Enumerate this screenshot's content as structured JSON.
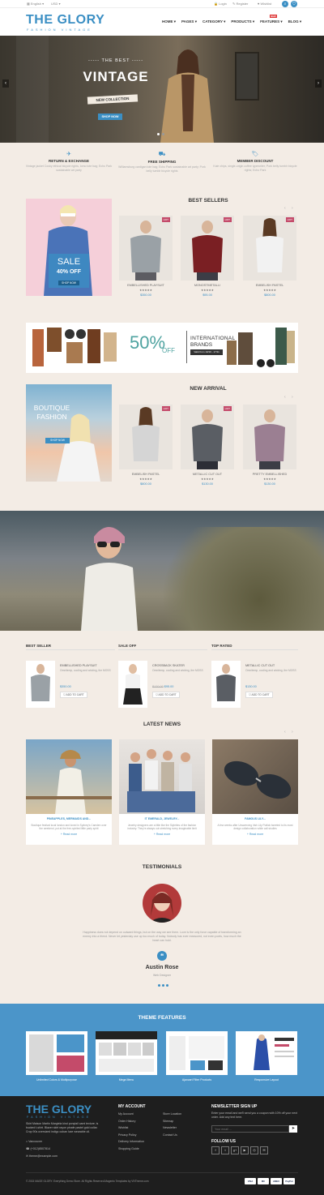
{
  "topbar": {
    "language": "English",
    "currency": "USD",
    "login": "Login",
    "register": "Register",
    "wishlist": "Wishlist"
  },
  "header": {
    "logo": "THE GLORY",
    "logo_sub": "FASHION VINTAGE",
    "nav": [
      "HOME",
      "PAGES",
      "CATEGORY",
      "PRODUCTS",
      "FEATURES",
      "BLOG"
    ],
    "new_badge": "NEW"
  },
  "hero": {
    "pre": "THE BEST",
    "title": "VINTAGE",
    "ribbon": "NEW COLLECTION",
    "button": "SHOP NOW"
  },
  "features": [
    {
      "icon": "plane-icon",
      "title": "RETURN & EXCHANGE",
      "text": "Vintage jacket Cosby ethical bicycle rights, lomo tote bag; Echo Park sustainable art party"
    },
    {
      "icon": "truck-icon",
      "title": "FREE SHIPPING",
      "text": "Williamsburg cardigan tote bag; Echo Park sustainable art party; Pork belly tumblr bicycle rights"
    },
    {
      "icon": "tag-icon",
      "title": "MEMBER DISCOUNT",
      "text": "Kale chips, single-origin coffee typewriter; Pork belly tumblr bicycle rights; Echo Park"
    }
  ],
  "best_sellers": {
    "title": "BEST SELLERS",
    "promo": {
      "title": "SALE",
      "sub": "40% OFF",
      "button": "SHOP NOW"
    },
    "hot": "HOT",
    "stars": "★★★★★",
    "products": [
      {
        "name": "EMBELLISHED PLAYSUIT",
        "price": "$350.00"
      },
      {
        "name": "MONOSTMETALLI",
        "price": "$95.00"
      },
      {
        "name": "EMBELISH PASTEL",
        "price": "$800.00"
      }
    ]
  },
  "banner": {
    "percent": "50%",
    "off": "OFF",
    "line1": "INTERNATIONAL",
    "line2": "BRANDS",
    "valid": "Valid from 10/10 - 17/11"
  },
  "new_arrival": {
    "title": "NEW ARRIVAL",
    "promo": {
      "line1": "BOUTIQUE",
      "line2": "FASHION",
      "button": "SHOP NOW"
    },
    "products": [
      {
        "name": "EMBELISH PASTEL",
        "price": "$800.00"
      },
      {
        "name": "METALLIC CUT OUT",
        "price": "$130.00"
      },
      {
        "name": "PRETTY EMBELLISHED",
        "price": "$130.00"
      }
    ]
  },
  "lists": [
    {
      "title": "BEST SELLER",
      "name": "EMBELLISHED PLAYSUIT",
      "desc": "Omnitemp, cooling and wicking, the MOSS",
      "price": "$350.00",
      "old_price": "",
      "button": "ADD TO CART"
    },
    {
      "title": "SALE OFF",
      "name": "CROSSBACK SKATER",
      "desc": "Omnitemp, cooling and wicking, the MOSS",
      "price": "$95.00",
      "old_price": "$120.00",
      "button": "ADD TO CART"
    },
    {
      "title": "TOP RATED",
      "name": "METALLIC CUT OUT",
      "desc": "Omnitemp, cooling and wicking, the MOSS",
      "price": "$130.00",
      "old_price": "",
      "button": "ADD TO CART"
    }
  ],
  "news": {
    "title": "LATEST NEWS",
    "read_more": "+ Read more",
    "items": [
      {
        "title": "PINEAPPLES, MERMAIDS AND...",
        "text": "Boutique festival local london and loved in Sydney's Camden over the weekend, put at the free-spirited little party spirit"
      },
      {
        "title": "IT EMERALD, JEWELRY...",
        "text": "Jewelry designers are a little like the Stylettes of the fashion industry. They're always out stretching every imaginable limit"
      },
      {
        "title": "FAMOUS LILY...",
        "text": "A few weeks after Unswerving Irish Lily Puttick tweeted to its most design collaboration white call studies"
      }
    ]
  },
  "testimonials": {
    "title": "TESTIMONIALS",
    "quote": "Happiness does not depend on outward things, but on the way we see them. Love is the only force capable of transforming an enemy into a friend. Never let yesterday use up too much of today. Nobody has ever measured, not even poets, how much the heart can hold.",
    "name": "Austin Rose",
    "role": "Web Designer"
  },
  "theme_features": {
    "title": "THEME FEATURES",
    "items": [
      "Unlimited Colors & Multipurpose",
      "Mega Menu",
      "Ajaxcart Filter Products",
      "Responsive Layout"
    ]
  },
  "footer": {
    "logo": "THE GLORY",
    "logo_sub": "FASHION VINTAGE",
    "about": "Skirt Maison Martin Margiela kind ponytail cami texture; is bucked t-shirt. Blazer skirt rayon pinafe pastel gold collar. Crop 90s oversized indigo cuban luxe wearable oil.",
    "address": "Vancouver",
    "phone": "(+012)8507814",
    "email": "theme@example.com",
    "my_account": {
      "title": "MY ACCOUNT",
      "col1": [
        "My Account",
        "Order History",
        "Wishlist",
        "Privacy Policy",
        "Delivery Information",
        "Shopping Guide"
      ],
      "col2": [
        "Store Location",
        "Sitemap",
        "Newsletter",
        "Contact Us"
      ]
    },
    "newsletter": {
      "title": "NEWSLETTER SIGN UP",
      "text": "Enter your email and we'll send you a coupon with 10% off your next order. Add any text here.",
      "placeholder": "Your email ..."
    },
    "follow": "FOLLOW US",
    "social": [
      "f",
      "t",
      "g+",
      "▶",
      "◎",
      "✉"
    ],
    "copyright": "© 2015 MAGE GLORY. Everything Demo Store. All Rights Reserved.Magento Templates by VNTheme.com",
    "payments": [
      "VISA",
      "MC",
      "AMEX",
      "PayPal"
    ]
  },
  "colors": {
    "accent": "#3b8fc4",
    "hot": "#c44b6a",
    "footer": "#1e1e1e"
  }
}
